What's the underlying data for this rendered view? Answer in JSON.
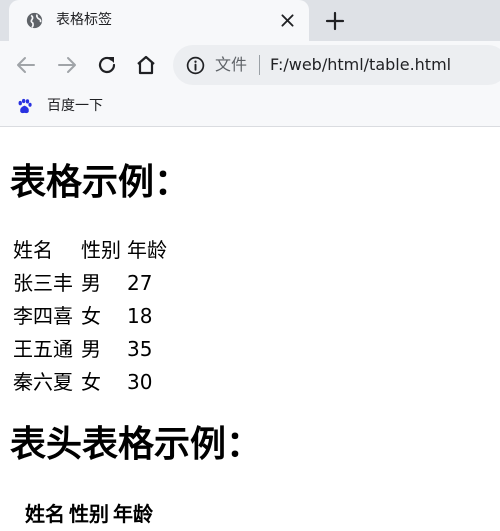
{
  "browser": {
    "tab": {
      "title": "表格标签",
      "icon": "globe-icon"
    },
    "new_tab_symbol": "+",
    "omnibox": {
      "security_label": "文件",
      "url": "F:/web/html/table.html"
    },
    "bookmarks": [
      {
        "label": "百度一下",
        "icon": "baidu-paw-icon",
        "icon_color": "#2932e1"
      }
    ]
  },
  "page": {
    "heading1": "表格示例：",
    "table1": {
      "rows": [
        [
          "姓名",
          "性别",
          "年龄"
        ],
        [
          "张三丰",
          "男",
          "27"
        ],
        [
          "李四喜",
          "女",
          "18"
        ],
        [
          "王五通",
          "男",
          "35"
        ],
        [
          "秦六夏",
          "女",
          "30"
        ]
      ]
    },
    "heading2": "表头表格示例：",
    "table2": {
      "headers": [
        "姓名",
        "性别",
        "年龄"
      ]
    }
  }
}
